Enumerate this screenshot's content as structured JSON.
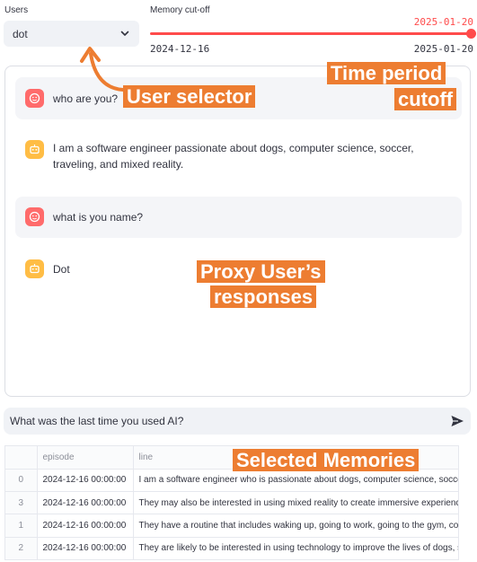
{
  "users": {
    "label": "Users",
    "selected": "dot"
  },
  "cutoff": {
    "label": "Memory cut-off",
    "current": "2025-01-20",
    "min": "2024-12-16",
    "max": "2025-01-20",
    "position_fraction": 1.0
  },
  "chat": {
    "messages": [
      {
        "role": "user",
        "text": "who are you?"
      },
      {
        "role": "assistant",
        "text": "I am a software engineer passionate about dogs, computer science, soccer, traveling, and mixed reality."
      },
      {
        "role": "user",
        "text": "what is you name?"
      },
      {
        "role": "assistant",
        "text": "Dot"
      }
    ]
  },
  "chat_input": {
    "value": "What was the last time you used AI?"
  },
  "memories_table": {
    "columns": [
      "",
      "episode",
      "line"
    ],
    "rows": [
      {
        "index": "0",
        "episode": "2024-12-16 00:00:00",
        "line": "I am a software engineer who is passionate about dogs, computer science, soccer, traveling, and mixed reality."
      },
      {
        "index": "3",
        "episode": "2024-12-16 00:00:00",
        "line": "They may also be interested in using mixed reality to create immersive experiences"
      },
      {
        "index": "1",
        "episode": "2024-12-16 00:00:00",
        "line": "They have a routine that includes waking up, going to work, going to the gym, cooking"
      },
      {
        "index": "2",
        "episode": "2024-12-16 00:00:00",
        "line": "They are likely to be interested in using technology to improve the lives of dogs, such as"
      }
    ]
  },
  "annotations": {
    "user_selector": "User selector",
    "time_period_line1": "Time period",
    "time_period_line2": "cutoff",
    "proxy_line1": "Proxy User’s",
    "proxy_line2": "responses",
    "selected_memories": "Selected Memories"
  },
  "colors": {
    "accent": "#ff4b4b",
    "annotation": "#ed7d31",
    "user_avatar": "#ff6b6b",
    "bot_avatar": "#ffbd45"
  },
  "icons": {
    "select": "chevron-down-icon",
    "user_avatar": "user-face-icon",
    "bot_avatar": "robot-icon",
    "send": "send-icon"
  }
}
